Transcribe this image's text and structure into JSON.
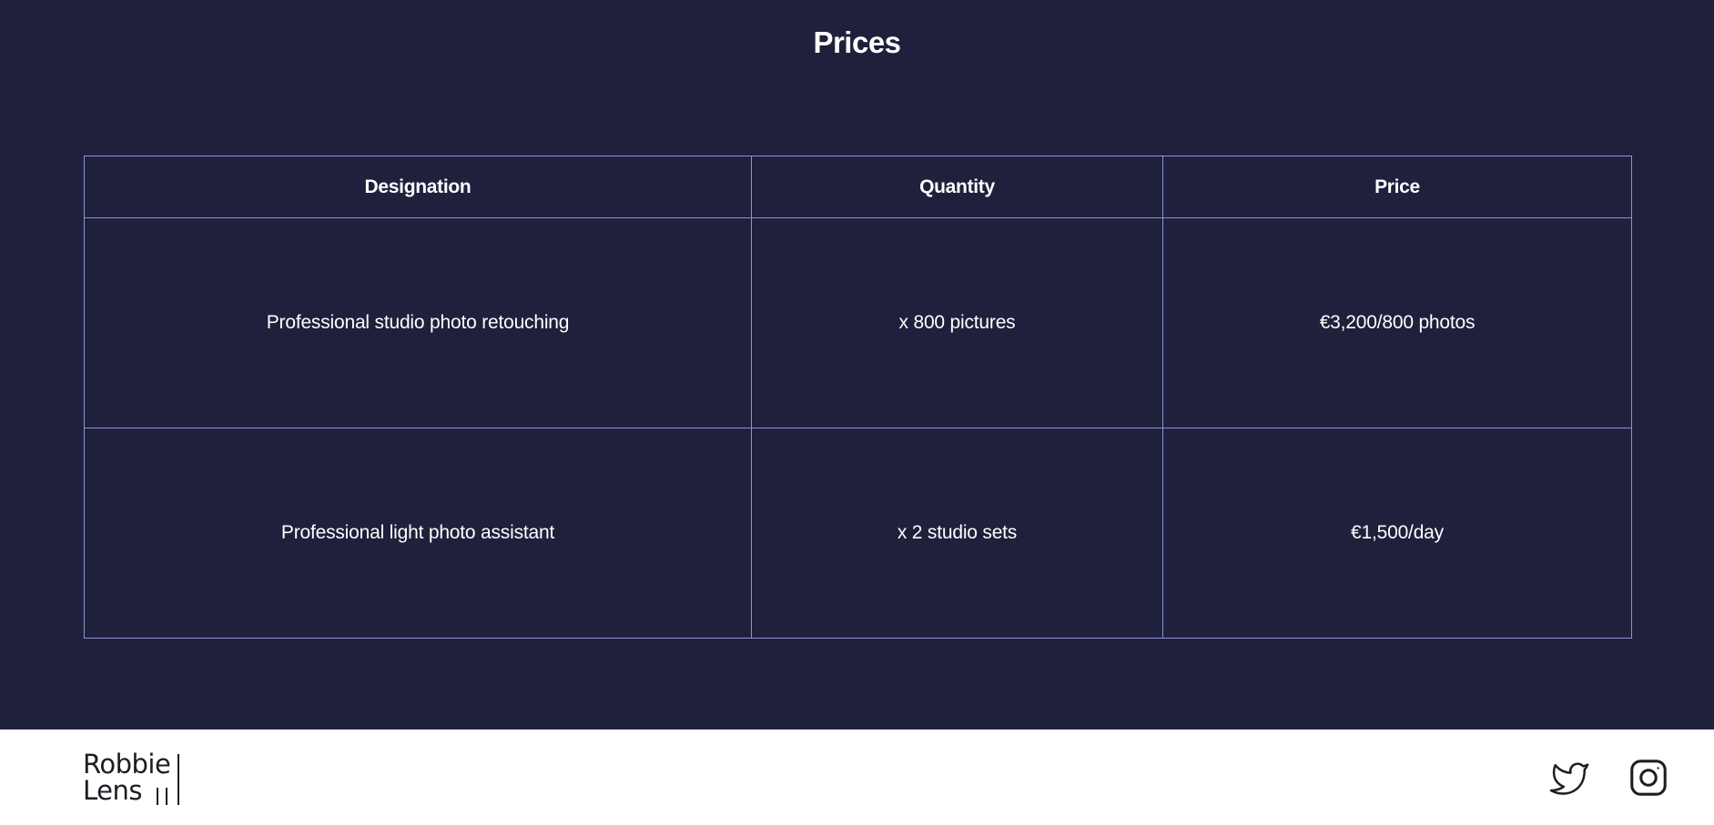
{
  "page": {
    "title": "Prices"
  },
  "table": {
    "headers": [
      "Designation",
      "Quantity",
      "Price"
    ],
    "rows": [
      [
        "Professional studio photo retouching",
        "x 800 pictures",
        "€3,200/800 photos"
      ],
      [
        "Professional light photo assistant",
        "x 2 studio sets",
        "€1,500/day"
      ]
    ]
  },
  "footer": {
    "logo": {
      "line1": "Robbie",
      "line2": "Lens"
    },
    "social": [
      "twitter-icon",
      "instagram-icon"
    ]
  },
  "colors": {
    "section_bg": "#1f203c",
    "table_border": "#8f92d8",
    "text": "#ffffff",
    "footer_bg": "#ffffff",
    "icon": "#1d1d24"
  }
}
